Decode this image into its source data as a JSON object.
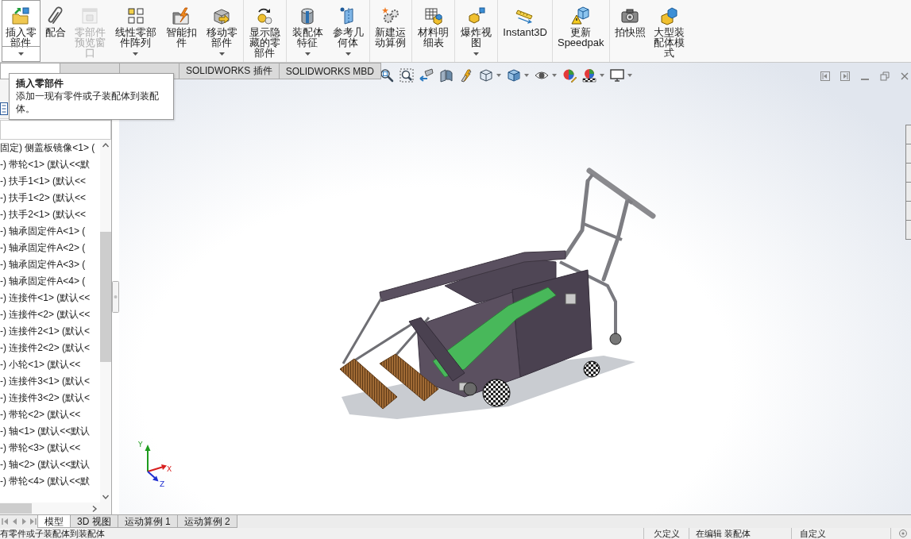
{
  "toolbar": {
    "groups": [
      {
        "buttons": [
          {
            "label": "插入零部件",
            "dropdown": true,
            "selected": true,
            "disabled": false
          },
          {
            "label": "配合",
            "dropdown": false,
            "selected": false,
            "disabled": false
          },
          {
            "label": "零部件预览窗口",
            "dropdown": false,
            "selected": false,
            "disabled": true
          },
          {
            "label": "线性零部件阵列",
            "dropdown": true,
            "selected": false,
            "disabled": false
          },
          {
            "label": "智能扣件",
            "dropdown": false,
            "selected": false,
            "disabled": false
          },
          {
            "label": "移动零部件",
            "dropdown": true,
            "selected": false,
            "disabled": false
          }
        ]
      },
      {
        "buttons": [
          {
            "label": "显示隐藏的零部件",
            "dropdown": false,
            "selected": false,
            "disabled": false
          }
        ]
      },
      {
        "buttons": [
          {
            "label": "装配体特征",
            "dropdown": true,
            "selected": false,
            "disabled": false
          },
          {
            "label": "参考几何体",
            "dropdown": true,
            "selected": false,
            "disabled": false
          }
        ]
      },
      {
        "buttons": [
          {
            "label": "新建运动算例",
            "dropdown": false,
            "selected": false,
            "disabled": false
          }
        ]
      },
      {
        "buttons": [
          {
            "label": "材料明细表",
            "dropdown": false,
            "selected": false,
            "disabled": false
          }
        ]
      },
      {
        "buttons": [
          {
            "label": "爆炸视图",
            "dropdown": true,
            "selected": false,
            "disabled": false
          }
        ]
      },
      {
        "buttons": [
          {
            "label": "Instant3D",
            "dropdown": false,
            "selected": false,
            "disabled": false
          }
        ]
      },
      {
        "buttons": [
          {
            "label": "更新 Speedpak",
            "dropdown": false,
            "selected": false,
            "disabled": false
          }
        ]
      },
      {
        "buttons": [
          {
            "label": "拍快照",
            "dropdown": false,
            "selected": false,
            "disabled": false
          },
          {
            "label": "大型装配体模式",
            "dropdown": false,
            "selected": false,
            "disabled": false
          }
        ]
      }
    ]
  },
  "command_tabs": [
    {
      "selected": true
    },
    {
      "selected": false
    },
    {
      "selected": false
    },
    {
      "label": "SOLIDWORKS 插件",
      "selected": false
    },
    {
      "label": "SOLIDWORKS MBD",
      "selected": false
    }
  ],
  "tooltip": {
    "title": "插入零部件",
    "text": "添加一现有零件或子装配体到装配体。"
  },
  "feature_tree": {
    "items": [
      "固定) 侧盖板镜像<1> (",
      "-) 带轮<1> (默认<<默",
      "-) 扶手1<1> (默认<<",
      "-) 扶手1<2> (默认<<",
      "-) 扶手2<1> (默认<<",
      "-) 轴承固定件A<1> (",
      "-) 轴承固定件A<2> (",
      "-) 轴承固定件A<3> (",
      "-) 轴承固定件A<4> (",
      "-) 连接件<1> (默认<<",
      "-) 连接件<2> (默认<<",
      "-) 连接件2<1> (默认<",
      "-) 连接件2<2> (默认<",
      "-) 小轮<1> (默认<<",
      "-) 连接件3<1> (默认<",
      "-) 连接件3<2> (默认<",
      "-) 带轮<2> (默认<<",
      "-) 轴<1> (默认<<默认",
      "-) 带轮<3> (默认<<",
      "-) 轴<2> (默认<<默认",
      "-) 带轮<4> (默认<<默"
    ]
  },
  "triad": {
    "axes": [
      {
        "label": "Y",
        "color": "#1e9c1e"
      },
      {
        "label": "X",
        "color": "#d81e1e"
      },
      {
        "label": "Z",
        "color": "#1e2ed0"
      }
    ]
  },
  "sheet_tabs": [
    {
      "label": "模型",
      "selected": true
    },
    {
      "label": "3D 视图",
      "selected": false
    },
    {
      "label": "运动算例 1",
      "selected": false
    },
    {
      "label": "运动算例 2",
      "selected": false
    }
  ],
  "status_bar": {
    "message": "有零件或子装配体到装配体",
    "fields": [
      "欠定义",
      "在编辑 装配体",
      "自定义"
    ]
  }
}
